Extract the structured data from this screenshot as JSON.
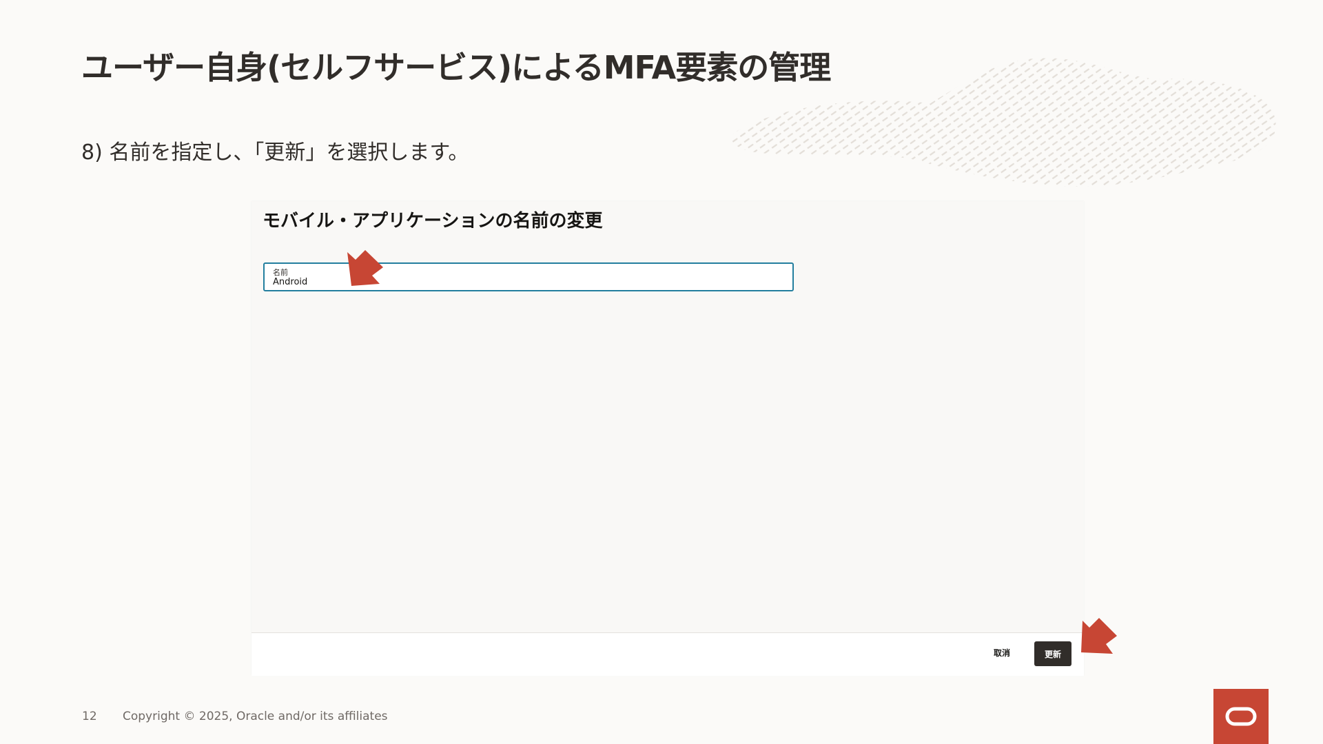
{
  "slide": {
    "title": "ユーザー自身(セルフサービス)によるMFA要素の管理",
    "step_text": "8) 名前を指定し、「更新」を選択します。",
    "page_number": "12",
    "copyright": "Copyright © 2025, Oracle and/or its affiliates"
  },
  "dialog": {
    "title": "モバイル・アプリケーションの名前の変更",
    "name_field": {
      "label": "名前",
      "value": "Android"
    },
    "cancel_label": "取消",
    "update_label": "更新"
  },
  "colors": {
    "accent_arrow": "#c74634",
    "oracle_red": "#c74634",
    "input_border": "#227e9e",
    "primary_button": "#312d2a"
  },
  "icons": {
    "logo": "oracle-logo-icon",
    "pointer": "arrow-pointer-icon"
  }
}
